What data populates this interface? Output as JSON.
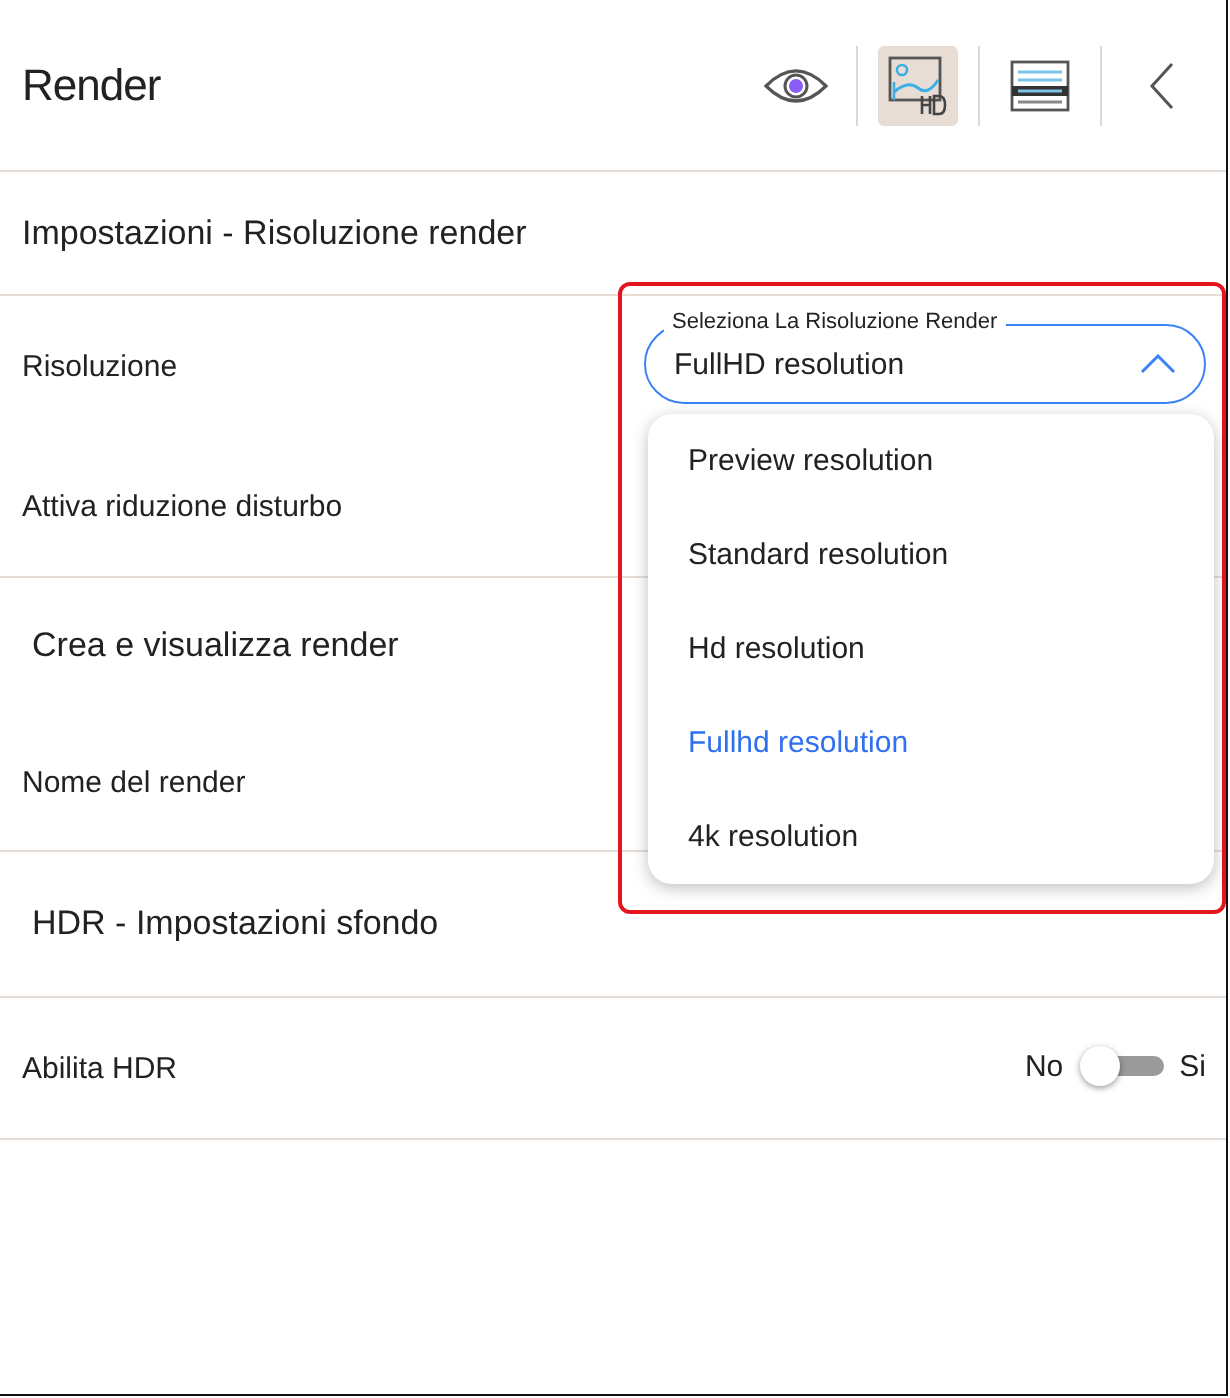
{
  "header": {
    "title": "Render",
    "tools": [
      {
        "kind": "eye",
        "selected": false
      },
      {
        "kind": "hd-image",
        "selected": true
      },
      {
        "kind": "layers",
        "selected": false
      },
      {
        "kind": "back",
        "selected": false
      }
    ]
  },
  "sections": [
    {
      "title": "Impostazioni - Risoluzione render",
      "rows": [
        {
          "label": "Risoluzione",
          "kind": "select"
        },
        {
          "label": "Attiva riduzione disturbo",
          "kind": "plain"
        }
      ]
    },
    {
      "title": "Crea e visualizza render",
      "rows": [
        {
          "label": "Nome del render",
          "kind": "plain"
        }
      ]
    },
    {
      "title": "HDR - Impostazioni sfondo",
      "rows": [
        {
          "label": "Abilita HDR",
          "kind": "toggle",
          "off_label": "No",
          "on_label": "Si",
          "on": false
        }
      ]
    }
  ],
  "select": {
    "label": "Seleziona La Risoluzione Render",
    "value": "FullHD resolution",
    "expanded": true,
    "options": [
      {
        "label": "Preview resolution",
        "selected": false
      },
      {
        "label": "Standard resolution",
        "selected": false
      },
      {
        "label": "Hd resolution",
        "selected": false
      },
      {
        "label": "Fullhd resolution",
        "selected": true
      },
      {
        "label": "4k resolution",
        "selected": false
      }
    ]
  }
}
